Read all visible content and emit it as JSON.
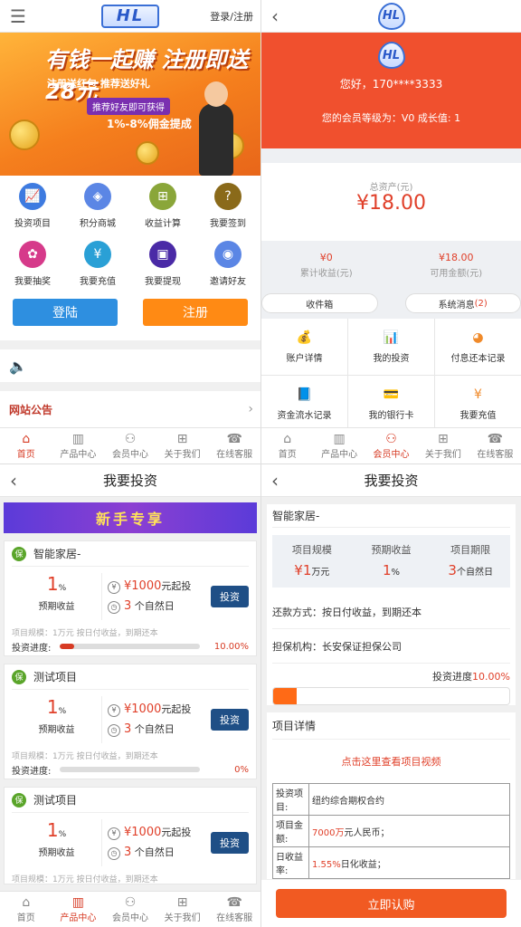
{
  "home": {
    "login_link": "登录/注册",
    "logo_text": "HL",
    "banner": {
      "headline": "有钱一起赚 注册即送28元",
      "sub": "注册送红包 推荐送好礼",
      "invite": "推荐好友即可获得",
      "commission": "1%-8%佣金提成"
    },
    "grid": [
      {
        "label": "投资项目",
        "icon": "chart-icon",
        "glyph": "📈",
        "color": "#3e7be0"
      },
      {
        "label": "积分商城",
        "icon": "shop-icon",
        "glyph": "◈",
        "color": "#5b86e5"
      },
      {
        "label": "收益计算",
        "icon": "calculator-icon",
        "glyph": "⊞",
        "color": "#8aa63a"
      },
      {
        "label": "我要签到",
        "icon": "question-icon",
        "glyph": "?",
        "color": "#8a6a1a"
      },
      {
        "label": "我要抽奖",
        "icon": "lottery-icon",
        "glyph": "✿",
        "color": "#d63a8a"
      },
      {
        "label": "我要充值",
        "icon": "recharge-icon",
        "glyph": "¥",
        "color": "#2aa0d6"
      },
      {
        "label": "我要提现",
        "icon": "withdraw-icon",
        "glyph": "▣",
        "color": "#4a2aa6"
      },
      {
        "label": "邀请好友",
        "icon": "invite-icon",
        "glyph": "◉",
        "color": "#5b86e5"
      }
    ],
    "login_btn": "登陆",
    "register_btn": "注册",
    "notice": "网站公告"
  },
  "nav": {
    "items": [
      {
        "label": "首页",
        "icon": "home-icon",
        "glyph": "⌂"
      },
      {
        "label": "产品中心",
        "icon": "bars-icon",
        "glyph": "▥"
      },
      {
        "label": "会员中心",
        "icon": "user-icon",
        "glyph": "⚇"
      },
      {
        "label": "关于我们",
        "icon": "grid-icon",
        "glyph": "⊞"
      },
      {
        "label": "在线客服",
        "icon": "service-icon",
        "glyph": "☎"
      }
    ]
  },
  "member": {
    "greeting": "您好，170****3333",
    "level_text": "您的会员等级为：V0 成长值: 1",
    "asset_label": "总资产(元)",
    "asset_value": "¥18.00",
    "stats": [
      {
        "value": "¥0",
        "label": "累计收益(元)"
      },
      {
        "value": "¥18.00",
        "label": "可用金额(元)"
      }
    ],
    "inbox": "收件箱",
    "system_msg": "系统消息",
    "system_count": "(2)",
    "grid": [
      {
        "label": "账户详情",
        "icon": "moneybag-icon",
        "glyph": "💰"
      },
      {
        "label": "我的投资",
        "icon": "barchart-icon",
        "glyph": "📊"
      },
      {
        "label": "付息还本记录",
        "icon": "pie-icon",
        "glyph": "◕"
      },
      {
        "label": "资金流水记录",
        "icon": "book-icon",
        "glyph": "📘"
      },
      {
        "label": "我的银行卡",
        "icon": "card-icon",
        "glyph": "💳"
      },
      {
        "label": "我要充值",
        "icon": "yen-icon",
        "glyph": "¥"
      }
    ]
  },
  "invest": {
    "title": "我要投资",
    "banner": "新手专享",
    "products": [
      {
        "name": "智能家居-",
        "rate": "1",
        "rate_unit": "%",
        "rate_label": "预期收益",
        "min": "¥1000",
        "min_suffix": "元起投",
        "days": "3",
        "days_suffix": "个自然日",
        "btn": "投资",
        "info": "项目规模：1万元   按日付收益，到期还本",
        "progress_label": "投资进度:",
        "progress_value": "10.00%",
        "progress": 10
      },
      {
        "name": "测试项目",
        "rate": "1",
        "rate_unit": "%",
        "rate_label": "预期收益",
        "min": "¥1000",
        "min_suffix": "元起投",
        "days": "3",
        "days_suffix": "个自然日",
        "btn": "投资",
        "info": "项目规模：1万元   按日付收益，到期还本",
        "progress_label": "投资进度:",
        "progress_value": "0%",
        "progress": 0
      },
      {
        "name": "测试项目",
        "rate": "1",
        "rate_unit": "%",
        "rate_label": "预期收益",
        "min": "¥1000",
        "min_suffix": "元起投",
        "days": "3",
        "days_suffix": "个自然日",
        "btn": "投资",
        "info": "项目规模：1万元   按日付收益，到期还本",
        "progress_label": "",
        "progress_value": "",
        "progress": 0
      }
    ]
  },
  "detail": {
    "title": "我要投资",
    "name": "智能家居-",
    "cols": [
      {
        "label": "项目规模",
        "value": "¥1",
        "unit": "万元"
      },
      {
        "label": "预期收益",
        "value": "1",
        "unit": "%"
      },
      {
        "label": "项目期限",
        "value": "3",
        "unit": "个自然日"
      }
    ],
    "repay": "还款方式：按日付收益，到期还本",
    "guarantor": "担保机构：长安保证担保公司",
    "progress_label": "投资进度",
    "progress_value": "10.00%",
    "progress": 10,
    "section": "项目详情",
    "video_link": "点击这里查看项目视频",
    "table": [
      {
        "k": "投资项目:",
        "v": "纽约综合期权合约",
        "vr": ""
      },
      {
        "k": "项目金额:",
        "v": "元人民币；",
        "vr": "7000万"
      },
      {
        "k": "日收益率:",
        "v": "日化收益；",
        "vr": "1.55%"
      }
    ],
    "buy_btn": "立即认购"
  }
}
